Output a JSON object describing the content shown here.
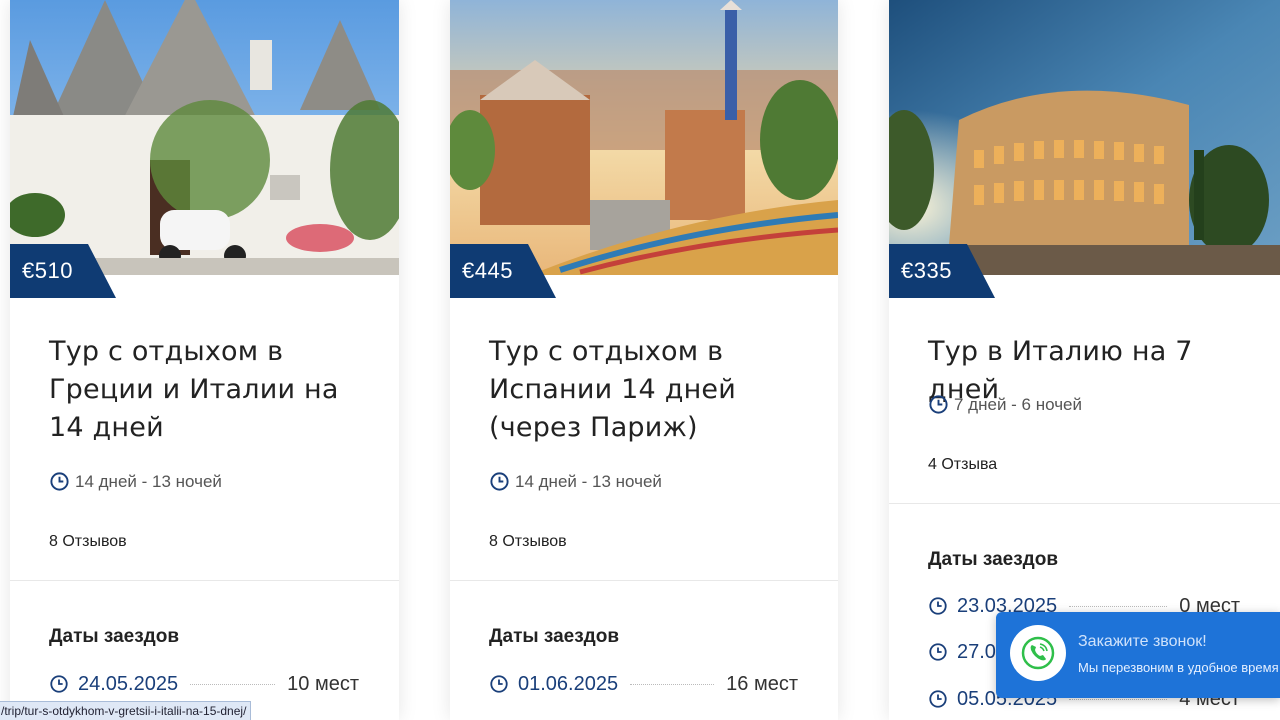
{
  "tours": [
    {
      "price": "€510",
      "title": "Тур с отдыхом в Греции и Италии на 14 дней",
      "duration": "14 дней - 13 ночей",
      "reviews": "8 Отзывов",
      "dates_heading": "Даты заездов",
      "dates": [
        {
          "date": "24.05.2025",
          "seats": "10 мест"
        }
      ]
    },
    {
      "price": "€445",
      "title": "Тур с отдыхом в Испании 14 дней (через Париж)",
      "duration": "14 дней - 13 ночей",
      "reviews": "8 Отзывов",
      "dates_heading": "Даты заездов",
      "dates": [
        {
          "date": "01.06.2025",
          "seats": "16 мест"
        }
      ]
    },
    {
      "price": "€335",
      "title": "Тур в Италию на 7 дней",
      "duration": "7 дней - 6 ночей",
      "reviews": "4 Отзыва",
      "dates_heading": "Даты заездов",
      "dates": [
        {
          "date": "23.03.2025",
          "seats": "0 мест"
        },
        {
          "date": "27.04.2025",
          "seats": ""
        },
        {
          "date": "05.05.2025",
          "seats": "4 мест"
        }
      ]
    }
  ],
  "status_bar": {
    "url": "/trip/tur-s-otdykhom-v-gretsii-i-italii-na-15-dnej/"
  },
  "callback_widget": {
    "title": "Закажите звонок!",
    "subtitle": "Мы перезвоним в удобное время"
  },
  "colors": {
    "price_ribbon": "#0f3b73",
    "date_text": "#1a3f7a",
    "callback_bg": "#1e73d8"
  }
}
